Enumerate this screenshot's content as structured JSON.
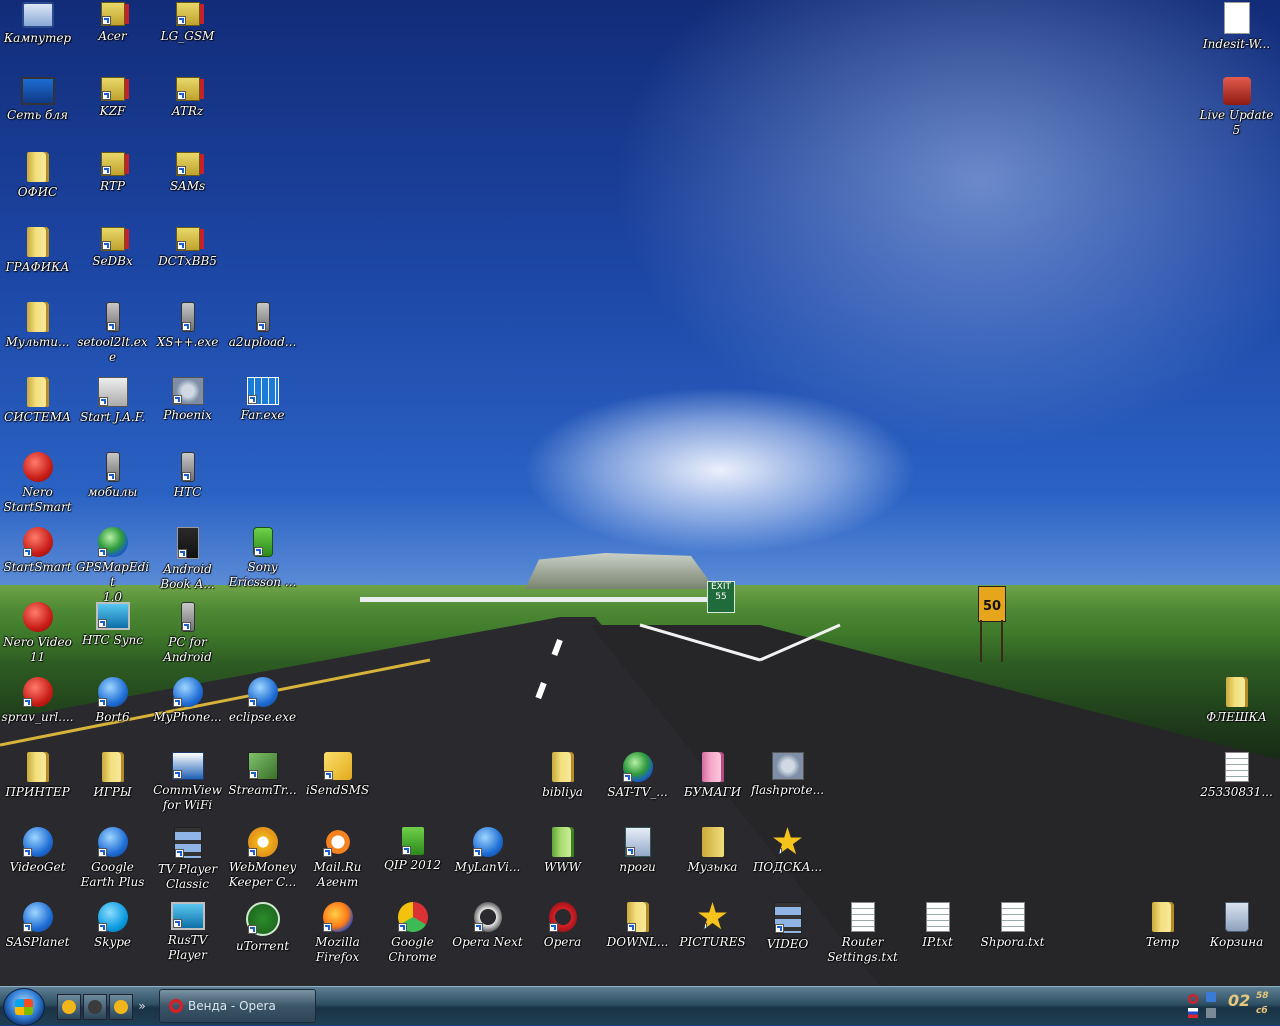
{
  "desktop": {
    "road_signs": {
      "exit_number": "55",
      "speed": "50"
    },
    "icons": [
      {
        "id": "kamputer",
        "label": "Кампутер",
        "glyph": "g-pc",
        "shortcut": false,
        "icon": "computer-icon"
      },
      {
        "id": "acer",
        "label": "Acer",
        "glyph": "g-netpc",
        "shortcut": true,
        "icon": "network-drive-icon"
      },
      {
        "id": "lg-gsm",
        "label": "LG_GSM",
        "glyph": "g-netpc",
        "shortcut": true,
        "icon": "network-drive-icon"
      },
      {
        "id": "set-blya",
        "label": "Сеть бля",
        "glyph": "g-monitor",
        "shortcut": false,
        "icon": "network-icon"
      },
      {
        "id": "kzf",
        "label": "KZF",
        "glyph": "g-netpc",
        "shortcut": true,
        "icon": "network-drive-icon"
      },
      {
        "id": "atrz",
        "label": "ATRz",
        "glyph": "g-netpc",
        "shortcut": true,
        "icon": "network-drive-icon"
      },
      {
        "id": "ofis",
        "label": "ОФИС",
        "glyph": "g-folder",
        "shortcut": false,
        "icon": "folder-icon"
      },
      {
        "id": "rtp",
        "label": "RTP",
        "glyph": "g-netpc",
        "shortcut": true,
        "icon": "network-drive-icon"
      },
      {
        "id": "sams",
        "label": "SAMs",
        "glyph": "g-netpc",
        "shortcut": true,
        "icon": "network-drive-icon"
      },
      {
        "id": "grafika",
        "label": "ГРАФИКА",
        "glyph": "g-folder",
        "shortcut": false,
        "icon": "folder-icon"
      },
      {
        "id": "sedbx",
        "label": "SeDBx",
        "glyph": "g-netpc",
        "shortcut": true,
        "icon": "network-drive-icon"
      },
      {
        "id": "dctxbb5",
        "label": "DCTxBB5",
        "glyph": "g-netpc",
        "shortcut": true,
        "icon": "network-drive-icon"
      },
      {
        "id": "multi",
        "label": "Мульти...",
        "glyph": "g-folder",
        "shortcut": false,
        "icon": "folder-icon"
      },
      {
        "id": "setool2lt",
        "label": "setool2lt.exe",
        "glyph": "g-phone",
        "shortcut": true,
        "icon": "phone-icon"
      },
      {
        "id": "xspp",
        "label": "XS++.exe",
        "glyph": "g-phone",
        "shortcut": true,
        "icon": "phone-tool-icon"
      },
      {
        "id": "a2upload",
        "label": "a2upload...",
        "glyph": "g-phone",
        "shortcut": true,
        "icon": "phone-icon"
      },
      {
        "id": "sistema",
        "label": "СИСТЕМА",
        "glyph": "g-folder",
        "shortcut": false,
        "icon": "folder-icon"
      },
      {
        "id": "start-jaf",
        "label": "Start J.A.F.",
        "glyph": "g-flag",
        "shortcut": true,
        "icon": "jaf-icon"
      },
      {
        "id": "phoenix",
        "label": "Phoenix",
        "glyph": "g-gear",
        "shortcut": true,
        "icon": "phoenix-icon"
      },
      {
        "id": "far",
        "label": "Far.exe",
        "glyph": "g-far",
        "shortcut": true,
        "icon": "far-manager-icon"
      },
      {
        "id": "nero-startsmart",
        "label": "Nero\nStartSmart",
        "glyph": "g-round-red",
        "shortcut": false,
        "icon": "nero-icon"
      },
      {
        "id": "mobily",
        "label": "мобилы",
        "glyph": "g-phone",
        "shortcut": true,
        "icon": "phone-icon"
      },
      {
        "id": "htc",
        "label": "HTC",
        "glyph": "g-phone",
        "shortcut": true,
        "icon": "pda-icon"
      },
      {
        "id": "startsmart",
        "label": "StartSmart",
        "glyph": "g-round-red",
        "shortcut": true,
        "icon": "power-icon"
      },
      {
        "id": "gpsmapedit",
        "label": "GPSMapEdit\n1.0",
        "glyph": "g-round-globe",
        "shortcut": true,
        "icon": "gps-icon"
      },
      {
        "id": "android-book",
        "label": "Android\nBook A...",
        "glyph": "g-android",
        "shortcut": true,
        "icon": "android-icon"
      },
      {
        "id": "sony-ericsson",
        "label": "Sony\nEricsson ...",
        "glyph": "g-green-phone",
        "shortcut": true,
        "icon": "sony-ericsson-icon"
      },
      {
        "id": "nero-video",
        "label": "Nero Video\n11",
        "glyph": "g-round-red",
        "shortcut": false,
        "icon": "nero-video-icon"
      },
      {
        "id": "htc-sync",
        "label": "HTC Sync",
        "glyph": "g-tv",
        "shortcut": true,
        "icon": "htc-sync-icon"
      },
      {
        "id": "pc-android",
        "label": "PC for\nAndroid",
        "glyph": "g-phone",
        "shortcut": true,
        "icon": "phone-icon"
      },
      {
        "id": "sprav-url",
        "label": "sprav_url....",
        "glyph": "g-round-red",
        "shortcut": true,
        "icon": "telephone-icon"
      },
      {
        "id": "bort6",
        "label": "Bort6",
        "glyph": "g-round-blue",
        "shortcut": true,
        "icon": "magnifier-icon"
      },
      {
        "id": "myphone",
        "label": "MyPhone...",
        "glyph": "g-round-blue",
        "shortcut": true,
        "icon": "sync-icon"
      },
      {
        "id": "eclipse",
        "label": "eclipse.exe",
        "glyph": "g-round-blue",
        "shortcut": true,
        "icon": "eclipse-icon"
      },
      {
        "id": "flashka",
        "label": "ФЛЕШКА",
        "glyph": "g-folder",
        "shortcut": false,
        "icon": "folder-icon"
      },
      {
        "id": "printer",
        "label": "ПРИНТЕР",
        "glyph": "g-folder",
        "shortcut": false,
        "icon": "folder-icon"
      },
      {
        "id": "igry",
        "label": "ИГРЫ",
        "glyph": "g-folder",
        "shortcut": false,
        "icon": "folder-icon"
      },
      {
        "id": "commview",
        "label": "CommView\nfor WiFi",
        "glyph": "g-commview",
        "shortcut": true,
        "icon": "commview-icon"
      },
      {
        "id": "streamtr",
        "label": "StreamTr...",
        "glyph": "g-stream",
        "shortcut": true,
        "icon": "stream-icon"
      },
      {
        "id": "isendsms",
        "label": "iSendSMS",
        "glyph": "g-yellow-sms",
        "shortcut": true,
        "icon": "sms-icon"
      },
      {
        "id": "bibliya",
        "label": "bibliya",
        "glyph": "g-folder",
        "shortcut": false,
        "icon": "folder-icon"
      },
      {
        "id": "sat-tv",
        "label": "SAT-TV_...",
        "glyph": "g-round-globe",
        "shortcut": true,
        "icon": "globe-icon"
      },
      {
        "id": "bumagi",
        "label": "БУМАГИ",
        "glyph": "g-folder-pink",
        "shortcut": false,
        "icon": "folder-icon"
      },
      {
        "id": "flashprote",
        "label": "flashprote...",
        "glyph": "g-gear",
        "shortcut": false,
        "icon": "settings-window-icon"
      },
      {
        "id": "file-2533",
        "label": "25330831...",
        "glyph": "g-doc",
        "shortcut": false,
        "icon": "file-icon"
      },
      {
        "id": "videoget",
        "label": "VideoGet",
        "glyph": "g-round-blue",
        "shortcut": true,
        "icon": "videoget-icon"
      },
      {
        "id": "google-earth",
        "label": "Google\nEarth Plus",
        "glyph": "g-round-blue",
        "shortcut": true,
        "icon": "google-earth-icon"
      },
      {
        "id": "tvplayer",
        "label": "TV Player\nClassic",
        "glyph": "g-filmstrip",
        "shortcut": true,
        "icon": "tv-player-icon"
      },
      {
        "id": "webmoney",
        "label": "WebMoney\nKeeper C...",
        "glyph": "g-webmoney",
        "shortcut": true,
        "icon": "webmoney-icon"
      },
      {
        "id": "mailru",
        "label": "Mail.Ru\nАгент",
        "glyph": "g-email",
        "shortcut": true,
        "icon": "mail-agent-icon"
      },
      {
        "id": "qip",
        "label": "QIP 2012",
        "glyph": "g-qip",
        "shortcut": true,
        "icon": "qip-icon"
      },
      {
        "id": "mylanvi",
        "label": "MyLanVi...",
        "glyph": "g-round-blue",
        "shortcut": true,
        "icon": "mylanviewer-icon"
      },
      {
        "id": "www",
        "label": "WWW",
        "glyph": "g-folder-green",
        "shortcut": false,
        "icon": "folder-icon"
      },
      {
        "id": "progi",
        "label": "проги",
        "glyph": "g-progi",
        "shortcut": true,
        "icon": "programs-icon"
      },
      {
        "id": "muzyka",
        "label": "Музыка",
        "glyph": "g-music",
        "shortcut": false,
        "icon": "folder-icon"
      },
      {
        "id": "podskazka",
        "label": "ПОДСКА...",
        "glyph": "g-star",
        "shortcut": true,
        "icon": "star-icon"
      },
      {
        "id": "indesit",
        "label": "Indesit-W...",
        "glyph": "g-pdf",
        "shortcut": false,
        "icon": "pdf-icon"
      },
      {
        "id": "live-update",
        "label": "Live Update\n5",
        "glyph": "g-live",
        "shortcut": false,
        "icon": "live-update-icon"
      },
      {
        "id": "sasplanet",
        "label": "SASPlanet",
        "glyph": "g-round-blue",
        "shortcut": true,
        "icon": "sasplanet-icon"
      },
      {
        "id": "skype",
        "label": "Skype",
        "glyph": "g-skype",
        "shortcut": true,
        "icon": "skype-icon"
      },
      {
        "id": "rustv",
        "label": "RusTV\nPlayer",
        "glyph": "g-tv",
        "shortcut": true,
        "icon": "rustv-icon"
      },
      {
        "id": "utorrent",
        "label": "uTorrent",
        "glyph": "g-utorrent",
        "shortcut": true,
        "icon": "utorrent-icon"
      },
      {
        "id": "firefox",
        "label": "Mozilla\nFirefox",
        "glyph": "g-firefox",
        "shortcut": true,
        "icon": "firefox-icon"
      },
      {
        "id": "chrome",
        "label": "Google\nChrome",
        "glyph": "g-chrome",
        "shortcut": true,
        "icon": "chrome-icon"
      },
      {
        "id": "opera-next",
        "label": "Opera Next",
        "glyph": "g-opera-next",
        "shortcut": true,
        "icon": "opera-next-icon"
      },
      {
        "id": "opera",
        "label": "Opera",
        "glyph": "g-opera",
        "shortcut": true,
        "icon": "opera-icon"
      },
      {
        "id": "downl",
        "label": "DOWNL...",
        "glyph": "g-folder",
        "shortcut": true,
        "icon": "folder-icon"
      },
      {
        "id": "pictures",
        "label": "PICTURES",
        "glyph": "g-star",
        "shortcut": true,
        "icon": "pictures-icon"
      },
      {
        "id": "video",
        "label": "VIDEO",
        "glyph": "g-filmstrip",
        "shortcut": true,
        "icon": "video-icon"
      },
      {
        "id": "router-settings",
        "label": "Router\nSettings.txt",
        "glyph": "g-doc",
        "shortcut": false,
        "icon": "text-file-icon"
      },
      {
        "id": "ip-txt",
        "label": "IP.txt",
        "glyph": "g-doc",
        "shortcut": false,
        "icon": "text-file-icon"
      },
      {
        "id": "shpora",
        "label": "Shpora.txt",
        "glyph": "g-doc",
        "shortcut": false,
        "icon": "text-file-icon"
      },
      {
        "id": "temp",
        "label": "Temp",
        "glyph": "g-folder",
        "shortcut": false,
        "icon": "folder-icon"
      },
      {
        "id": "korzina",
        "label": "Корзина",
        "glyph": "g-recycle",
        "shortcut": false,
        "icon": "recycle-bin-icon"
      }
    ]
  },
  "taskbar": {
    "quick_launch": [
      {
        "id": "ql-1",
        "icon": "opera-ql-icon",
        "color": "#f2b51a"
      },
      {
        "id": "ql-2",
        "icon": "window-ql-icon",
        "color": "#3b3b3b"
      },
      {
        "id": "ql-3",
        "icon": "media-ql-icon",
        "color": "#f2b51a"
      }
    ],
    "more_label": "»",
    "active_task": "Венда - Opera",
    "clock": {
      "time": "02",
      "minutes": "58",
      "day": "сб"
    }
  }
}
